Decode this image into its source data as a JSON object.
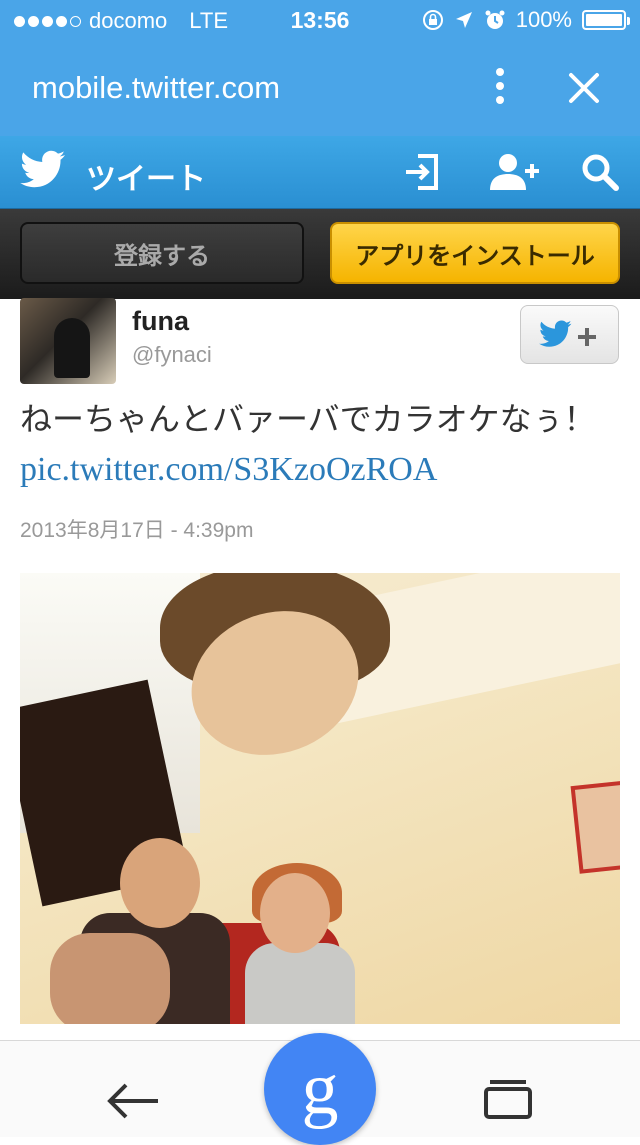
{
  "status_bar": {
    "carrier": "docomo",
    "network": "LTE",
    "time": "13:56",
    "battery": "100%",
    "signal_bars_filled": 4,
    "signal_bars_total": 5
  },
  "browser": {
    "url": "mobile.twitter.com"
  },
  "twitter_header": {
    "title": "ツイート"
  },
  "cta": {
    "register_label": "登録する",
    "install_label": "アプリをインストール"
  },
  "tweet": {
    "name": "funa",
    "handle": "@fynaci",
    "text": "ねーちゃんとバァーバでカラオケなぅ！",
    "link": "pic.twitter.com/S3KzoOzROA",
    "timestamp": "2013年8月17日 - 4:39pm"
  },
  "bottom_bar": {
    "google_label": "g"
  },
  "colors": {
    "twitter_blue": "#4aa5e8",
    "install_yellow": "#f5b400",
    "google_blue": "#4285f4",
    "link_blue": "#2b7bb9"
  },
  "icons": [
    "wifi-signal-icon",
    "rotation-lock-icon",
    "location-arrow-icon",
    "alarm-icon",
    "battery-icon",
    "more-vertical-icon",
    "close-icon",
    "twitter-bird-icon",
    "login-icon",
    "follow-person-icon",
    "search-icon",
    "follow-button-icon",
    "back-arrow-icon",
    "tabs-icon"
  ]
}
